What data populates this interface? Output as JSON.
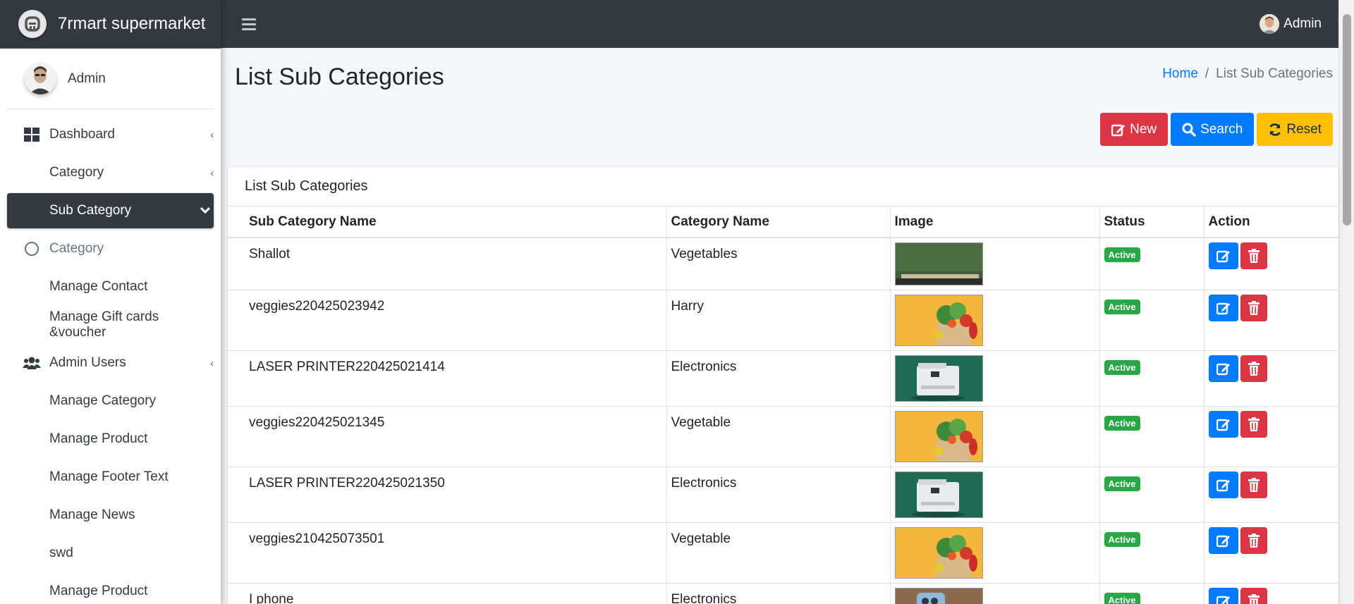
{
  "brand": {
    "name": "7rmart supermarket",
    "logo_icon": "brand-logo-icon"
  },
  "user_panel": {
    "name": "Admin"
  },
  "sidebar": {
    "items": [
      {
        "label": "Dashboard",
        "icon": "dashboard-icon",
        "caret": "‹"
      },
      {
        "label": "Category",
        "icon": "",
        "caret": "‹"
      },
      {
        "label": "Sub Category",
        "icon": "",
        "caret": "chevron-down",
        "active": true
      },
      {
        "label": "Category",
        "icon": "circle-icon"
      },
      {
        "label": "Manage Contact"
      },
      {
        "label": "Manage Gift cards &voucher"
      },
      {
        "label": "Admin Users",
        "icon": "users-icon",
        "caret": "‹"
      },
      {
        "label": "Manage Category"
      },
      {
        "label": "Manage Product"
      },
      {
        "label": "Manage Footer Text"
      },
      {
        "label": "Manage News"
      },
      {
        "label": "swd"
      },
      {
        "label": "Manage Product"
      }
    ]
  },
  "topbar": {
    "user_name": "Admin"
  },
  "header": {
    "title": "List Sub Categories",
    "breadcrumb": {
      "home": "Home",
      "separator": "/",
      "current": "List Sub Categories"
    }
  },
  "toolbar": {
    "new_label": "New",
    "search_label": "Search",
    "reset_label": "Reset"
  },
  "card": {
    "title": "List Sub Categories"
  },
  "table": {
    "columns": [
      "Sub Category Name",
      "Category Name",
      "Image",
      "Status",
      "Action"
    ],
    "rows": [
      {
        "name": "Shallot",
        "category": "Vegetables",
        "image": "green-wall",
        "status": "Active"
      },
      {
        "name": "veggies220425023942",
        "category": "Harry",
        "image": "veggies",
        "status": "Active"
      },
      {
        "name": "LASER PRINTER220425021414",
        "category": "Electronics",
        "image": "printer",
        "status": "Active"
      },
      {
        "name": "veggies220425021345",
        "category": "Vegetable",
        "image": "veggies",
        "status": "Active"
      },
      {
        "name": "LASER PRINTER220425021350",
        "category": "Electronics",
        "image": "printer",
        "status": "Active"
      },
      {
        "name": "veggies210425073501",
        "category": "Vegetable",
        "image": "veggies",
        "status": "Active"
      },
      {
        "name": "I phone",
        "category": "Electronics",
        "image": "phone",
        "status": "Active"
      }
    ]
  },
  "colors": {
    "primary": "#007bff",
    "danger": "#dc3545",
    "warning": "#ffc107",
    "success": "#28a745",
    "dark": "#343a40"
  }
}
